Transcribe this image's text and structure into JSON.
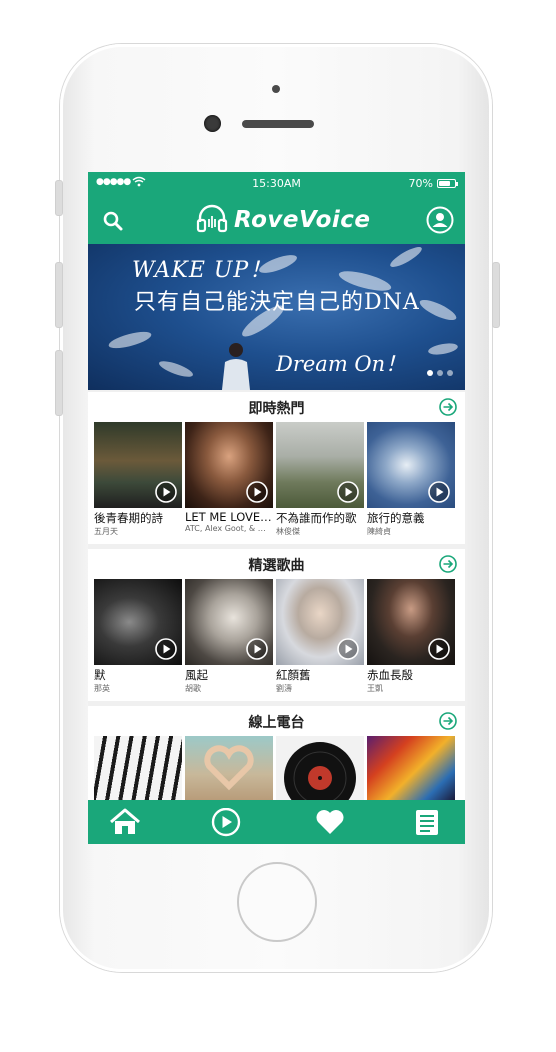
{
  "status": {
    "signal": "●●●●●",
    "time": "15:30AM",
    "battery_pct": "70%",
    "battery_level": 0.7
  },
  "app": {
    "name": "RoveVoice",
    "brand_color": "#1aa77a"
  },
  "banner": {
    "line1": "WAKE UP！",
    "line2": "只有自己能決定自己的DNA",
    "line3": "Dream On！",
    "page_count": 3,
    "active_page": 1
  },
  "sections": [
    {
      "title": "即時熱門",
      "items": [
        {
          "title": "後青春期的詩",
          "artist": "五月天"
        },
        {
          "title": "LET ME LOVE…",
          "artist": "ATC, Alex Goot, & …"
        },
        {
          "title": "不為誰而作的歌",
          "artist": "林俊傑"
        },
        {
          "title": "旅行的意義",
          "artist": "陳綺貞"
        }
      ]
    },
    {
      "title": "精選歌曲",
      "items": [
        {
          "title": "默",
          "artist": "那英"
        },
        {
          "title": "風起",
          "artist": "胡歌"
        },
        {
          "title": "紅顏舊",
          "artist": "劉濤"
        },
        {
          "title": "赤血長殷",
          "artist": "王凱"
        }
      ]
    },
    {
      "title": "線上電台",
      "items": []
    }
  ],
  "icons": {
    "search": "search-icon",
    "user": "user-icon",
    "section_more": "arrow-right-circle-icon",
    "play": "play-icon",
    "tab_home": "home-icon",
    "tab_player": "play-circle-icon",
    "tab_favorites": "heart-icon",
    "tab_list": "list-icon"
  }
}
